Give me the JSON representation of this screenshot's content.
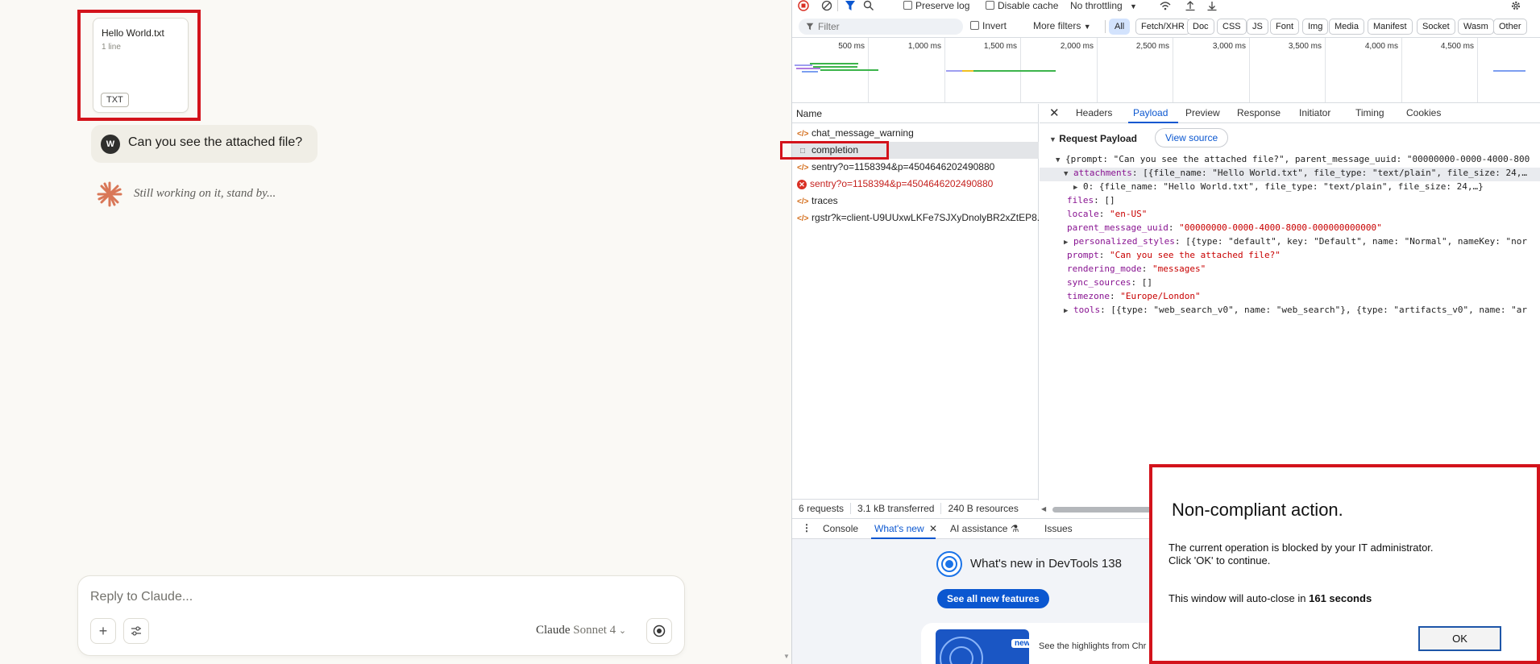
{
  "chat": {
    "attachment": {
      "file_name": "Hello World.txt",
      "lines": "1 line",
      "type_badge": "TXT"
    },
    "user_message": {
      "avatar_initial": "W",
      "text": "Can you see the attached file?"
    },
    "assistant_status": "Still working on it, stand by...",
    "reply": {
      "placeholder": "Reply to Claude...",
      "model_name": "Claude",
      "model_variant": "Sonnet 4"
    }
  },
  "devtools": {
    "toolbar": {
      "preserve_log": "Preserve log",
      "disable_cache": "Disable cache",
      "throttling": "No throttling"
    },
    "filter": {
      "placeholder": "Filter",
      "invert": "Invert",
      "more_filters": "More filters",
      "types": [
        "All",
        "Fetch/XHR",
        "Doc",
        "CSS",
        "JS",
        "Font",
        "Img",
        "Media",
        "Manifest",
        "Socket",
        "Wasm",
        "Other"
      ],
      "active_type": "All"
    },
    "timeline": {
      "ticks": [
        "500 ms",
        "1,000 ms",
        "1,500 ms",
        "2,000 ms",
        "2,500 ms",
        "3,000 ms",
        "3,500 ms",
        "4,000 ms",
        "4,500 ms"
      ]
    },
    "requests": {
      "header": "Name",
      "items": [
        {
          "name": "chat_message_warning",
          "kind": "fetch"
        },
        {
          "name": "completion",
          "kind": "doc",
          "selected": true
        },
        {
          "name": "sentry?o=1158394&p=4504646202490880",
          "kind": "fetch"
        },
        {
          "name": "sentry?o=1158394&p=4504646202490880",
          "kind": "error"
        },
        {
          "name": "traces",
          "kind": "fetch"
        },
        {
          "name": "rgstr?k=client-U9UUxwLKFe7SJXyDnolyBR2xZtEP8...",
          "kind": "fetch"
        }
      ]
    },
    "detail_tabs": [
      "Headers",
      "Payload",
      "Preview",
      "Response",
      "Initiator",
      "Timing",
      "Cookies"
    ],
    "active_detail_tab": "Payload",
    "payload": {
      "title": "Request Payload",
      "view_source": "View source",
      "root": "{prompt: \"Can you see the attached file?\", parent_message_uuid: \"00000000-0000-4000-800",
      "attachments_key": "attachments",
      "attachments_val": "[{file_name: \"Hello World.txt\", file_type: \"text/plain\", file_size: 24,…",
      "attachment_0": "0: {file_name: \"Hello World.txt\", file_type: \"text/plain\", file_size: 24,…}",
      "files_key": "files",
      "files_val": "[]",
      "locale_key": "locale",
      "locale_val": "\"en-US\"",
      "parent_key": "parent_message_uuid",
      "parent_val": "\"00000000-0000-4000-8000-000000000000\"",
      "styles_key": "personalized_styles",
      "styles_val": "[{type: \"default\", key: \"Default\", name: \"Normal\", nameKey: \"nor",
      "prompt_key": "prompt",
      "prompt_val": "\"Can you see the attached file?\"",
      "rendering_key": "rendering_mode",
      "rendering_val": "\"messages\"",
      "sync_key": "sync_sources",
      "sync_val": "[]",
      "tz_key": "timezone",
      "tz_val": "\"Europe/London\"",
      "tools_key": "tools",
      "tools_val": "[{type: \"web_search_v0\", name: \"web_search\"}, {type: \"artifacts_v0\", name: \"ar"
    },
    "status": {
      "requests": "6 requests",
      "transferred": "3.1 kB transferred",
      "resources": "240 B resources"
    },
    "drawer": {
      "tabs": [
        "Console",
        "What's new",
        "AI assistance",
        "Issues"
      ],
      "active": "What's new",
      "whats_new_title": "What's new in DevTools 138",
      "see_all": "See all new features",
      "new_badge": "new",
      "highlights": "See the highlights from Chr"
    }
  },
  "dialog": {
    "title": "Non-compliant action.",
    "body_line1": "The current operation is blocked by your IT administrator.",
    "body_line2": "Click 'OK' to continue.",
    "countdown_prefix": "This window will auto-close in ",
    "countdown_value": "161 seconds",
    "ok_label": "OK"
  },
  "colors": {
    "highlight_red": "#d3131b",
    "devtools_blue": "#0b57d0",
    "claude_orange": "#d97757"
  }
}
